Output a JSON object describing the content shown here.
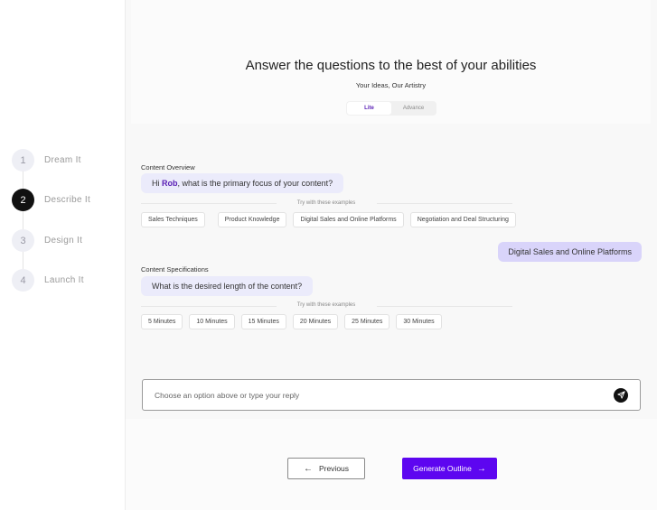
{
  "sidebar": {
    "steps": [
      {
        "number": "1",
        "label": "Dream It",
        "active": false
      },
      {
        "number": "2",
        "label": "Describe It",
        "active": true
      },
      {
        "number": "3",
        "label": "Design It",
        "active": false
      },
      {
        "number": "4",
        "label": "Launch It",
        "active": false
      }
    ]
  },
  "header": {
    "title": "Answer the questions to the best of your abilities",
    "subtitle": "Your Ideas, Our Artistry",
    "toggle": {
      "options": [
        "Lite",
        "Advance"
      ],
      "selected": "Lite"
    }
  },
  "chat": {
    "overview": {
      "section_label": "Content Overview",
      "question_prefix": "Hi ",
      "user_name": "Rob",
      "question_suffix": ", what is the primary focus of your content?",
      "examples_hint": "Try with these examples",
      "options": [
        "Sales Techniques",
        "Product Knowledge",
        "Digital Sales and Online Platforms",
        "Negotiation and Deal Structuring"
      ],
      "user_reply": "Digital Sales and Online Platforms"
    },
    "specifications": {
      "section_label": "Content Specifications",
      "question": "What is the desired length of the content?",
      "examples_hint": "Try with these examples",
      "options": [
        "5 Minutes",
        "10 Minutes",
        "15 Minutes",
        "20 Minutes",
        "25 Minutes",
        "30 Minutes"
      ]
    }
  },
  "reply_input": {
    "placeholder": "Choose an option above or type your reply",
    "value": ""
  },
  "footer": {
    "previous_label": "Previous",
    "generate_label": "Generate Outline"
  },
  "colors": {
    "accent": "#5d06f0",
    "user_bubble": "#d9d4fa",
    "bot_bubble": "#ebebfb",
    "active_step": "#111111"
  }
}
